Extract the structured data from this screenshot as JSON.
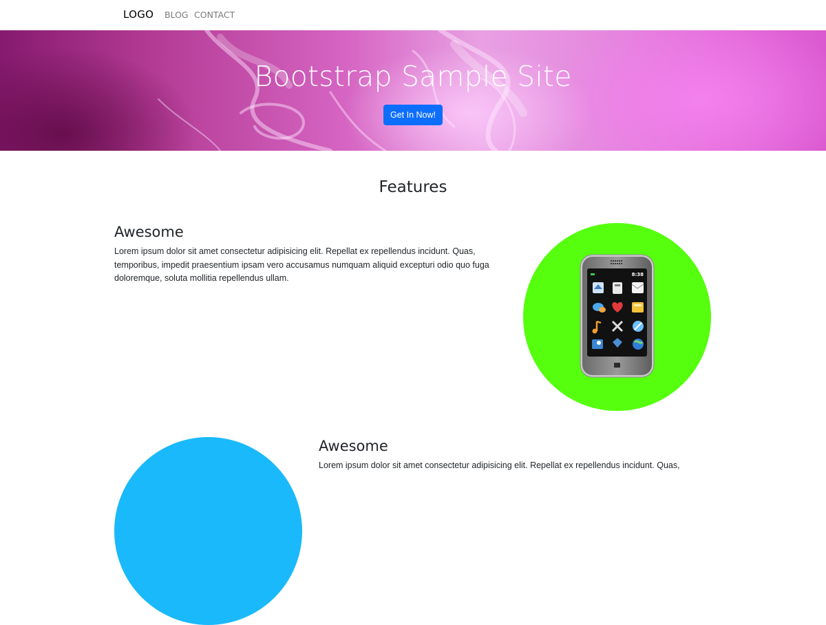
{
  "nav": {
    "brand": "LOGO",
    "links": [
      "BLOG",
      "CONTACT"
    ]
  },
  "hero": {
    "title": "Bootstrap Sample Site",
    "button_label": "Get In Now!",
    "button_color": "#0d6efd"
  },
  "features": {
    "title": "Features",
    "items": [
      {
        "heading": "Awesome",
        "text": "Lorem ipsum dolor sit amet consectetur adipisicing elit. Repellat ex repellendus incidunt. Quas, temporibus, impedit praesentium ipsam vero accusamus numquam aliquid excepturi odio quo fuga doloremque, soluta mollitia repellendus ullam.",
        "circle_color": "#55ff0e",
        "image": "smartphone-icon",
        "phone_time": "8:38"
      },
      {
        "heading": "Awesome",
        "text": "Lorem ipsum dolor sit amet consectetur adipisicing elit. Repellat ex repellendus incidunt. Quas,",
        "circle_color": "#1ab9fb"
      }
    ]
  }
}
